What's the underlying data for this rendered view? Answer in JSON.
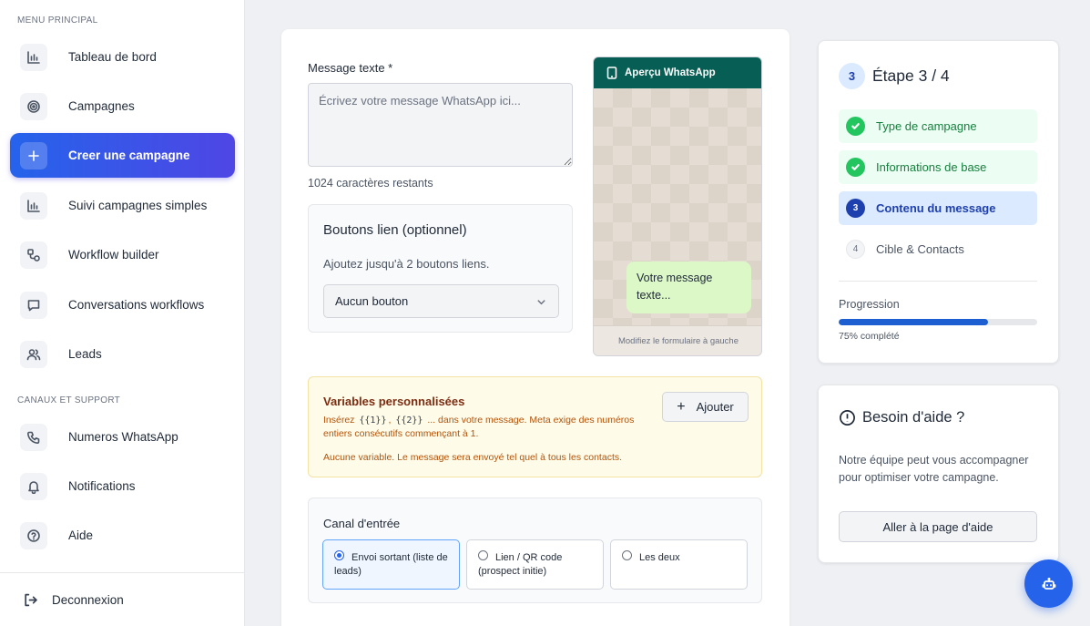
{
  "sidebar": {
    "section_main": "MENU PRINCIPAL",
    "section_support": "CANAUX ET SUPPORT",
    "items": [
      {
        "label": "Tableau de bord",
        "icon": "bar-chart-icon"
      },
      {
        "label": "Campagnes",
        "icon": "target-icon"
      },
      {
        "label": "Creer une campagne",
        "icon": "plus-icon",
        "active": true
      },
      {
        "label": "Suivi campagnes simples",
        "icon": "bar-chart-icon"
      },
      {
        "label": "Workflow builder",
        "icon": "workflow-icon"
      },
      {
        "label": "Conversations workflows",
        "icon": "chat-icon"
      },
      {
        "label": "Leads",
        "icon": "users-icon"
      }
    ],
    "support_items": [
      {
        "label": "Numeros WhatsApp",
        "icon": "phone-icon"
      },
      {
        "label": "Notifications",
        "icon": "bell-icon"
      },
      {
        "label": "Aide",
        "icon": "help-circle-icon"
      }
    ],
    "logout_label": "Deconnexion"
  },
  "form": {
    "message_label": "Message texte *",
    "message_placeholder": "Écrivez votre message WhatsApp ici...",
    "message_value": "",
    "chars_remaining": "1024 caractères restants",
    "link_buttons": {
      "title": "Boutons lien (optionnel)",
      "description": "Ajoutez jusqu'à 2 boutons liens.",
      "select_value": "Aucun bouton"
    }
  },
  "preview": {
    "header": "Aperçu WhatsApp",
    "bubble_text": "Votre message texte...",
    "footer": "Modifiez le formulaire à gauche"
  },
  "variables": {
    "title": "Variables personnalisées",
    "desc_prefix": "Insérez",
    "var1": "{{1}}",
    "sep": ",",
    "var2": "{{2}}",
    "desc_suffix": "... dans votre message. Meta exige des numéros entiers consécutifs commençant à 1.",
    "none_text": "Aucune variable. Le message sera envoyé tel quel à tous les contacts.",
    "add_button": "Ajouter"
  },
  "canal": {
    "title": "Canal d'entrée",
    "options": [
      {
        "label": "Envoi sortant (liste de leads)",
        "selected": true
      },
      {
        "label": "Lien / QR code (prospect initie)",
        "selected": false
      },
      {
        "label": "Les deux",
        "selected": false
      }
    ]
  },
  "steps": {
    "current_number": "3",
    "title": "Étape 3 / 4",
    "items": [
      {
        "number": "1",
        "label": "Type de campagne",
        "state": "done"
      },
      {
        "number": "2",
        "label": "Informations de base",
        "state": "done"
      },
      {
        "number": "3",
        "label": "Contenu du message",
        "state": "current"
      },
      {
        "number": "4",
        "label": "Cible & Contacts",
        "state": "todo"
      }
    ],
    "progress_label": "Progression",
    "progress_value": 0.75,
    "progress_text": "75% complété"
  },
  "help": {
    "title": "Besoin d'aide ?",
    "text": "Notre équipe peut vous accompagner pour optimiser votre campagne.",
    "button": "Aller à la page d'aide"
  },
  "fab": {
    "icon": "bot-icon"
  },
  "colors": {
    "accent": "#2563eb",
    "accent_gradient_end": "#4f46e5",
    "whatsapp_header": "#075e54",
    "success": "#22c55e",
    "warning_bg": "#fefbe8"
  }
}
